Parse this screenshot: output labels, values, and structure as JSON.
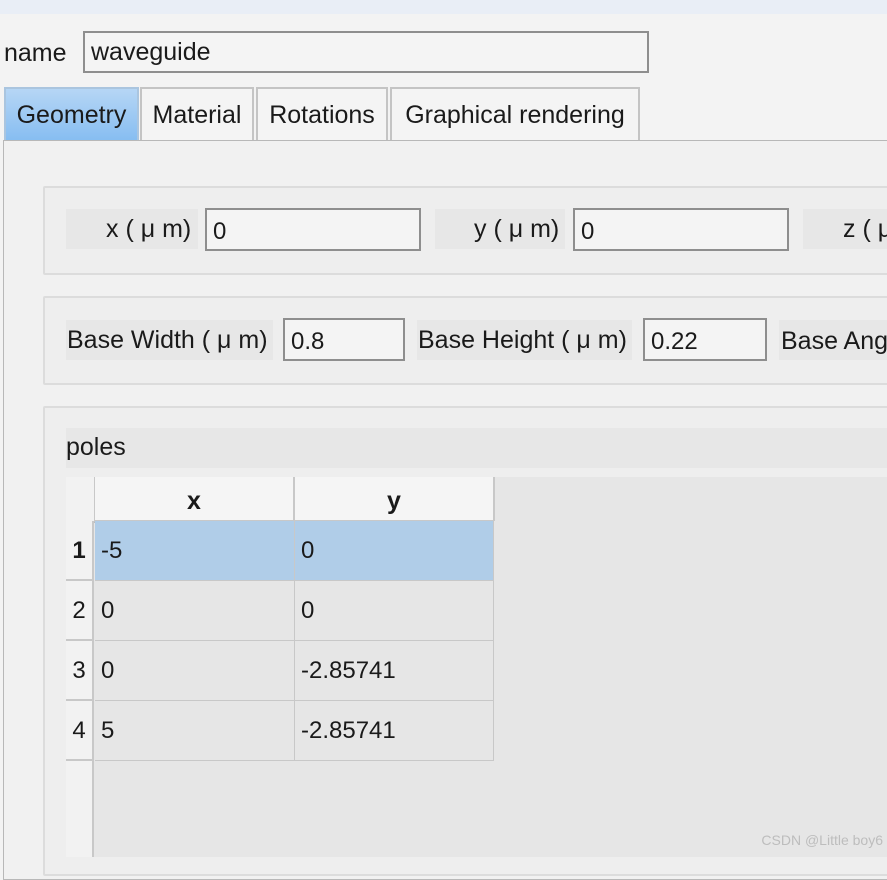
{
  "name_row": {
    "label": "name",
    "value": "waveguide"
  },
  "tabs": [
    {
      "label": "Geometry"
    },
    {
      "label": "Material"
    },
    {
      "label": "Rotations"
    },
    {
      "label": "Graphical rendering"
    }
  ],
  "position": {
    "x_label": "x ( μ m)",
    "x_value": "0",
    "y_label": "y ( μ m)",
    "y_value": "0",
    "z_label_partial": "z ( μ"
  },
  "base": {
    "width_label": "Base Width ( μ m)",
    "width_value": "0.8",
    "height_label": "Base Height ( μ m)",
    "height_value": "0.22",
    "angle_label_partial": "Base Ang"
  },
  "poles": {
    "title": "poles",
    "columns": [
      "x",
      "y"
    ],
    "rows": [
      {
        "index": "1",
        "x": "-5",
        "y": "0",
        "selected": true
      },
      {
        "index": "2",
        "x": "0",
        "y": "0"
      },
      {
        "index": "3",
        "x": "0",
        "y": "-2.85741"
      },
      {
        "index": "4",
        "x": "5",
        "y": "-2.85741"
      }
    ]
  },
  "colors": {
    "selected_row": "#b0cde8",
    "active_tab": "#86bdf1"
  },
  "watermark": "CSDN @Little boy6"
}
